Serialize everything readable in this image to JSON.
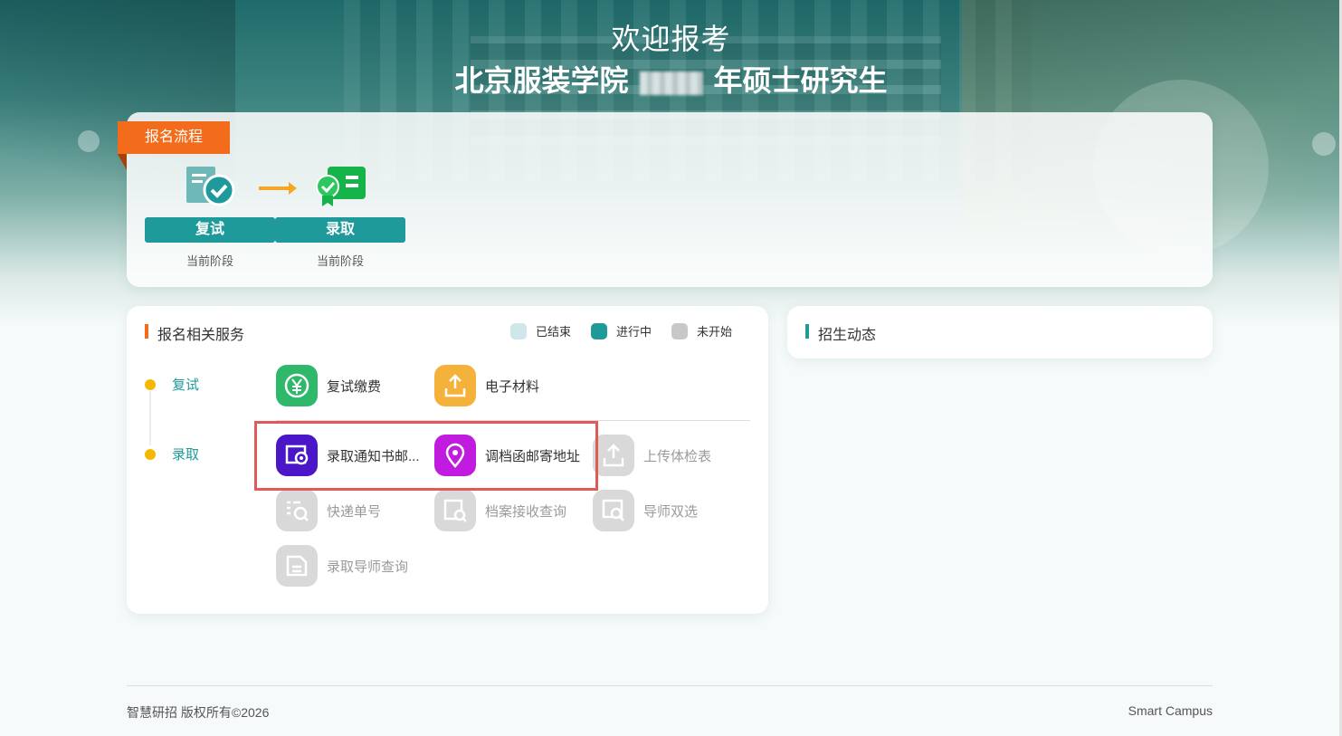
{
  "header": {
    "welcome": "欢迎报考",
    "title_prefix": "北京服装学院",
    "title_suffix": "年硕士研究生"
  },
  "flow": {
    "tag": "报名流程",
    "steps": [
      {
        "label": "复试",
        "status": "当前阶段",
        "icon": "document-check-icon"
      },
      {
        "label": "录取",
        "status": "当前阶段",
        "icon": "admission-certificate-icon"
      }
    ]
  },
  "services": {
    "title": "报名相关服务",
    "legend": [
      {
        "label": "已结束",
        "color": "#cfe6ea"
      },
      {
        "label": "进行中",
        "color": "#1f9a9a"
      },
      {
        "label": "未开始",
        "color": "#c8c8c8"
      }
    ],
    "stages": [
      {
        "label": "复试",
        "items": [
          {
            "label": "复试缴费",
            "icon": "yuan-coin-icon",
            "color": "#2db86a",
            "state": "active"
          },
          {
            "label": "电子材料",
            "icon": "upload-tray-icon",
            "color": "#f5b23a",
            "state": "active"
          }
        ]
      },
      {
        "label": "录取",
        "items": [
          {
            "label": "录取通知书邮...",
            "icon": "certificate-gear-icon",
            "color": "#4b16c8",
            "state": "active"
          },
          {
            "label": "调档函邮寄地址",
            "icon": "location-pin-icon",
            "color": "#c21be0",
            "state": "active"
          },
          {
            "label": "上传体检表",
            "icon": "upload-tray-icon",
            "color": "#d9d9d9",
            "state": "inactive"
          },
          {
            "label": "快递单号",
            "icon": "list-search-icon",
            "color": "#d9d9d9",
            "state": "inactive"
          },
          {
            "label": "档案接收查询",
            "icon": "file-search-icon",
            "color": "#d9d9d9",
            "state": "inactive"
          },
          {
            "label": "导师双选",
            "icon": "window-search-icon",
            "color": "#d9d9d9",
            "state": "inactive"
          },
          {
            "label": "录取导师查询",
            "icon": "folder-doc-icon",
            "color": "#d9d9d9",
            "state": "inactive"
          }
        ]
      }
    ]
  },
  "news": {
    "title": "招生动态"
  },
  "footer": {
    "copyright": "智慧研招 版权所有©2026",
    "brand": "Smart Campus"
  }
}
